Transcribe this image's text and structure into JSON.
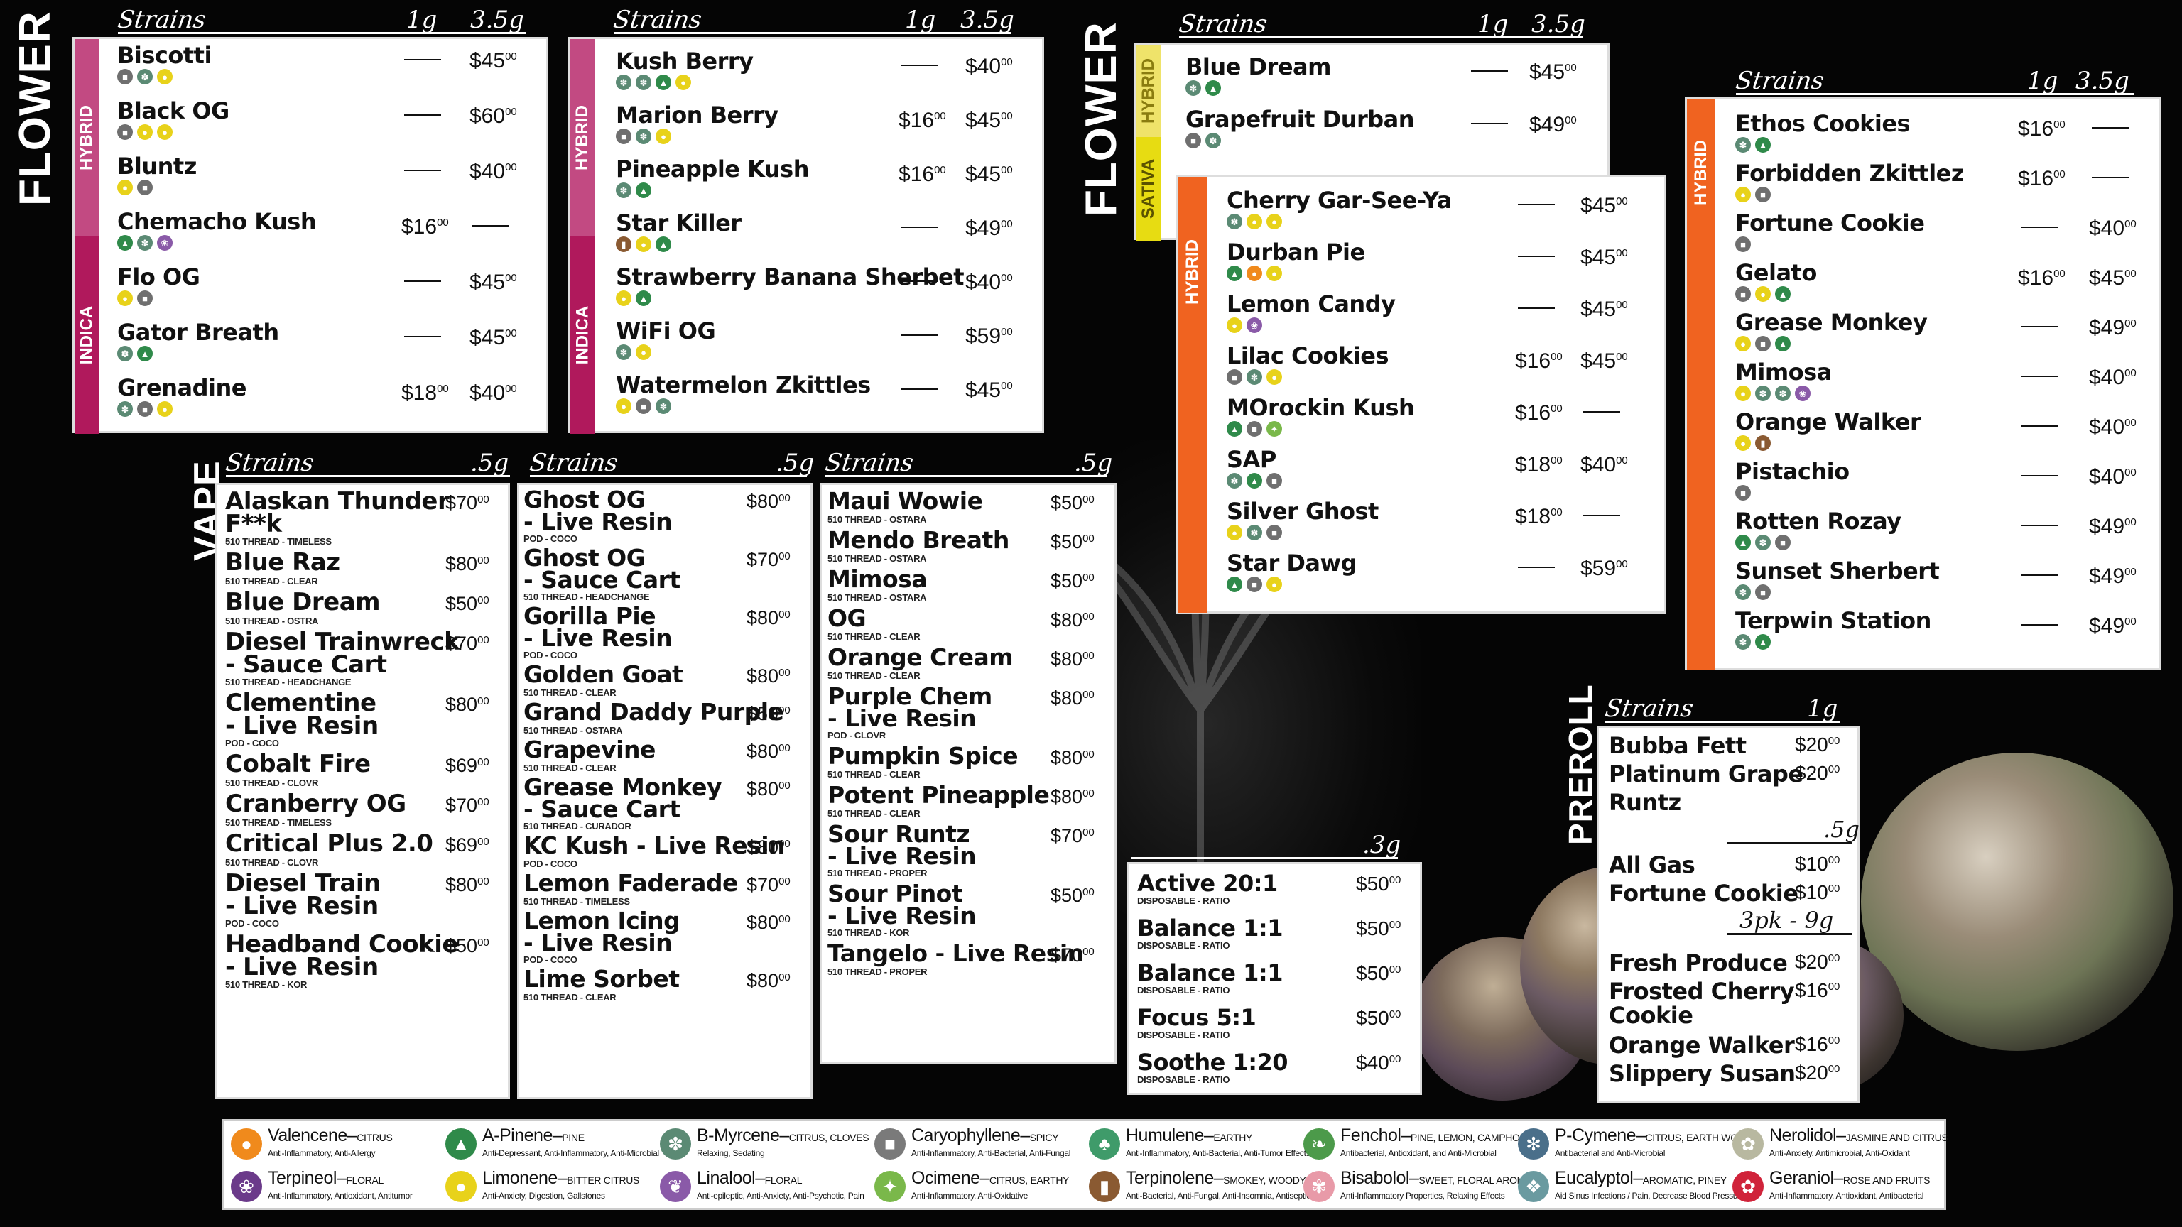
{
  "sections": {
    "flower": "FLOWER",
    "vape": "VAPE",
    "preroll": "PREROLL"
  },
  "headers": {
    "strains": "Strains",
    "g1": "1g",
    "g35": "3.5g",
    "g05": ".5g",
    "g03": ".3g",
    "pk3": "3pk - 9g"
  },
  "tags": {
    "indica_hybrid_a": {
      "indica": "INDICA",
      "hybrid": "HYBRID"
    },
    "indica_hybrid_b": {
      "indica": "INDICA",
      "hybrid": "HYBRID"
    },
    "sativa_hybrid": {
      "sativa": "SATIVA",
      "hybrid": "HYBRID"
    },
    "hybrid_mid": "HYBRID",
    "hybrid_right": "HYBRID"
  },
  "panel1": [
    {
      "name": "Biscotti",
      "p1": "",
      "p2": "$45",
      "icons": [
        "gray",
        "sage",
        "yellow"
      ]
    },
    {
      "name": "Black OG",
      "p1": "",
      "p2": "$60",
      "icons": [
        "gray",
        "yellow",
        "yellow"
      ]
    },
    {
      "name": "Bluntz",
      "p1": "",
      "p2": "$40",
      "icons": [
        "yellow",
        "gray"
      ]
    },
    {
      "name": "Chemacho Kush",
      "p1": "$16",
      "p2": "",
      "icons": [
        "pine",
        "sage",
        "purple"
      ]
    },
    {
      "name": "Flo OG",
      "p1": "",
      "p2": "$45",
      "icons": [
        "yellow",
        "gray"
      ]
    },
    {
      "name": "Gator Breath",
      "p1": "",
      "p2": "$45",
      "icons": [
        "sage",
        "pine"
      ]
    },
    {
      "name": "Grenadine",
      "p1": "$18",
      "p2": "$40",
      "icons": [
        "sage",
        "gray",
        "yellow"
      ]
    }
  ],
  "panel2": [
    {
      "name": "Kush Berry",
      "p1": "",
      "p2": "$40",
      "icons": [
        "sage",
        "sage",
        "pine",
        "yellow"
      ]
    },
    {
      "name": "Marion Berry",
      "p1": "$16",
      "p2": "$45",
      "icons": [
        "gray",
        "sage",
        "yellow"
      ]
    },
    {
      "name": "Pineapple Kush",
      "p1": "$16",
      "p2": "$45",
      "icons": [
        "sage",
        "pine"
      ]
    },
    {
      "name": "Star Killer",
      "p1": "",
      "p2": "$49",
      "icons": [
        "wood",
        "yellow",
        "pine"
      ]
    },
    {
      "name": "Strawberry Banana Sherbet",
      "p1": "",
      "p2": "$40",
      "icons": [
        "yellow",
        "pine"
      ]
    },
    {
      "name": "WiFi OG",
      "p1": "",
      "p2": "$59",
      "icons": [
        "sage",
        "yellow"
      ]
    },
    {
      "name": "Watermelon Zkittles",
      "p1": "",
      "p2": "$45",
      "icons": [
        "yellow",
        "gray",
        "sage"
      ]
    }
  ],
  "panel3": [
    {
      "name": "Blue Dream",
      "p1": "",
      "p2": "$45",
      "icons": [
        "sage",
        "pine"
      ]
    },
    {
      "name": "Grapefruit Durban",
      "p1": "",
      "p2": "$49",
      "icons": [
        "gray",
        "sage"
      ]
    }
  ],
  "panel4": [
    {
      "name": "Cherry Gar-See-Ya",
      "p1": "",
      "p2": "$45",
      "icons": [
        "sage",
        "yellow",
        "yellow"
      ]
    },
    {
      "name": "Durban Pie",
      "p1": "",
      "p2": "$45",
      "icons": [
        "pine",
        "orange",
        "yellow"
      ]
    },
    {
      "name": "Lemon Candy",
      "p1": "",
      "p2": "$45",
      "icons": [
        "yellow",
        "purple"
      ]
    },
    {
      "name": "Lilac Cookies",
      "p1": "$16",
      "p2": "$45",
      "icons": [
        "gray",
        "sage",
        "yellow"
      ]
    },
    {
      "name": "MOrockin Kush",
      "p1": "$16",
      "p2": "",
      "icons": [
        "pine",
        "gray",
        "mint"
      ]
    },
    {
      "name": "SAP",
      "p1": "$18",
      "p2": "$40",
      "icons": [
        "sage",
        "pine",
        "gray"
      ]
    },
    {
      "name": "Silver Ghost",
      "p1": "$18",
      "p2": "",
      "icons": [
        "yellow",
        "sage",
        "gray"
      ]
    },
    {
      "name": "Star Dawg",
      "p1": "",
      "p2": "$59",
      "icons": [
        "pine",
        "gray",
        "yellow"
      ]
    }
  ],
  "panel5": [
    {
      "name": "Ethos Cookies",
      "p1": "$16",
      "p2": "",
      "icons": [
        "sage",
        "pine"
      ]
    },
    {
      "name": "Forbidden Zkittlez",
      "p1": "$16",
      "p2": "",
      "icons": [
        "yellow",
        "gray"
      ]
    },
    {
      "name": "Fortune Cookie",
      "p1": "",
      "p2": "$40",
      "icons": [
        "gray"
      ]
    },
    {
      "name": "Gelato",
      "p1": "$16",
      "p2": "$45",
      "icons": [
        "gray",
        "yellow",
        "pine"
      ]
    },
    {
      "name": "Grease Monkey",
      "p1": "",
      "p2": "$49",
      "icons": [
        "yellow",
        "gray",
        "pine"
      ]
    },
    {
      "name": "Mimosa",
      "p1": "",
      "p2": "$40",
      "icons": [
        "yellow",
        "sage",
        "sage",
        "purple"
      ]
    },
    {
      "name": "Orange Walker",
      "p1": "",
      "p2": "$40",
      "icons": [
        "yellow",
        "wood"
      ]
    },
    {
      "name": "Pistachio",
      "p1": "",
      "p2": "$40",
      "icons": [
        "gray"
      ]
    },
    {
      "name": "Rotten Rozay",
      "p1": "",
      "p2": "$49",
      "icons": [
        "pine",
        "sage",
        "gray"
      ]
    },
    {
      "name": "Sunset Sherbert",
      "p1": "",
      "p2": "$49",
      "icons": [
        "sage",
        "gray"
      ]
    },
    {
      "name": "Terpwin Station",
      "p1": "",
      "p2": "$49",
      "icons": [
        "sage",
        "pine"
      ]
    }
  ],
  "vape1": [
    {
      "name": "Alaskan Thunder",
      "name2": "F**k",
      "sub": "510 THREAD - TIMELESS",
      "price": "$70"
    },
    {
      "name": "Blue Raz",
      "name2": "",
      "sub": "510 THREAD - CLEAR",
      "price": "$80"
    },
    {
      "name": "Blue Dream",
      "name2": "",
      "sub": "510 THREAD - OSTRA",
      "price": "$50"
    },
    {
      "name": "Diesel Trainwreck",
      "name2": "- Sauce Cart",
      "sub": "510 THREAD - HEADCHANGE",
      "price": "$70"
    },
    {
      "name": "Clementine",
      "name2": "- Live Resin",
      "sub": "POD - COCO",
      "price": "$80"
    },
    {
      "name": "Cobalt Fire",
      "name2": "",
      "sub": "510 THREAD - CLOVR",
      "price": "$69"
    },
    {
      "name": "Cranberry OG",
      "name2": "",
      "sub": "510 THREAD - TIMELESS",
      "price": "$70"
    },
    {
      "name": "Critical Plus 2.0",
      "name2": "",
      "sub": "510 THREAD - CLOVR",
      "price": "$69"
    },
    {
      "name": "Diesel Train",
      "name2": "- Live Resin",
      "sub": "POD - COCO",
      "price": "$80"
    },
    {
      "name": "Headband Cookie",
      "name2": "- Live Resin",
      "sub": "510 THREAD - KOR",
      "price": "$50"
    }
  ],
  "vape2": [
    {
      "name": "Ghost OG",
      "name2": "- Live Resin",
      "sub": "POD - COCO",
      "price": "$80"
    },
    {
      "name": "Ghost OG",
      "name2": "- Sauce Cart",
      "sub": "510 THREAD - HEADCHANGE",
      "price": "$70"
    },
    {
      "name": "Gorilla Pie",
      "name2": "- Live Resin",
      "sub": "POD - COCO",
      "price": "$80"
    },
    {
      "name": "Golden Goat",
      "name2": "",
      "sub": "510 THREAD - CLEAR",
      "price": "$80"
    },
    {
      "name": "Grand Daddy Purple",
      "name2": "",
      "sub": "510 THREAD - OSTARA",
      "price": "$50"
    },
    {
      "name": "Grapevine",
      "name2": "",
      "sub": "510 THREAD - CLEAR",
      "price": "$80"
    },
    {
      "name": "Grease Monkey",
      "name2": "- Sauce Cart",
      "sub": "510 THREAD - CURADOR",
      "price": "$80"
    },
    {
      "name": "KC Kush - Live Resin",
      "name2": "",
      "sub": "POD - COCO",
      "price": "$80"
    },
    {
      "name": "Lemon Faderade",
      "name2": "",
      "sub": "510 THREAD - TIMELESS",
      "price": "$70"
    },
    {
      "name": "Lemon Icing",
      "name2": "- Live Resin",
      "sub": "POD - COCO",
      "price": "$80"
    },
    {
      "name": "Lime Sorbet",
      "name2": "",
      "sub": "510 THREAD - CLEAR",
      "price": "$80"
    }
  ],
  "vape3": [
    {
      "name": "Maui Wowie",
      "name2": "",
      "sub": "510 THREAD - OSTARA",
      "price": "$50"
    },
    {
      "name": "Mendo Breath",
      "name2": "",
      "sub": "510 THREAD - OSTARA",
      "price": "$50"
    },
    {
      "name": "Mimosa",
      "name2": "",
      "sub": "510 THREAD - OSTARA",
      "price": "$50"
    },
    {
      "name": "OG",
      "name2": "",
      "sub": "510 THREAD - CLEAR",
      "price": "$80"
    },
    {
      "name": "Orange Cream",
      "name2": "",
      "sub": "510 THREAD - CLEAR",
      "price": "$80"
    },
    {
      "name": "Purple Chem",
      "name2": "- Live Resin",
      "sub": "POD - CLOVR",
      "price": "$80"
    },
    {
      "name": "Pumpkin Spice",
      "name2": "",
      "sub": "510 THREAD - CLEAR",
      "price": "$80"
    },
    {
      "name": "Potent Pineapple",
      "name2": "",
      "sub": "510 THREAD - CLEAR",
      "price": "$80"
    },
    {
      "name": "Sour Runtz",
      "name2": "- Live Resin",
      "sub": "510 THREAD - PROPER",
      "price": "$70"
    },
    {
      "name": "Sour Pinot",
      "name2": "- Live Resin",
      "sub": "510 THREAD - KOR",
      "price": "$50"
    },
    {
      "name": "Tangelo - Live Resin",
      "name2": "",
      "sub": "510 THREAD - PROPER",
      "price": "$70"
    }
  ],
  "disposable": [
    {
      "name": "Active 20:1",
      "sub": "DISPOSABLE - RATIO",
      "price": "$50"
    },
    {
      "name": "Balance 1:1",
      "sub": "DISPOSABLE - RATIO",
      "price": "$50"
    },
    {
      "name": "Balance 1:1",
      "sub": "DISPOSABLE - RATIO",
      "price": "$50"
    },
    {
      "name": "Focus 5:1",
      "sub": "DISPOSABLE - RATIO",
      "price": "$50"
    },
    {
      "name": "Soothe 1:20",
      "sub": "DISPOSABLE - RATIO",
      "price": "$40"
    }
  ],
  "preroll": {
    "g1": [
      {
        "name": "Bubba Fett",
        "price": "$20"
      },
      {
        "name": "Platinum Grape",
        "price": "$20"
      },
      {
        "name": "Runtz",
        "price": ""
      }
    ],
    "g05": [
      {
        "name": "All Gas",
        "price": "$10"
      },
      {
        "name": "Fortune Cookie",
        "price": "$10"
      }
    ],
    "pk": [
      {
        "name": "Fresh Produce",
        "price": "$20"
      },
      {
        "name": "Frosted Cherry",
        "name2": "Cookie",
        "price": "$16"
      },
      {
        "name": "Orange Walker",
        "price": "$16"
      },
      {
        "name": "Slippery Susan",
        "price": "$20"
      }
    ]
  },
  "cents": "00",
  "legend": [
    {
      "name": "Valencene",
      "tag": "CITRUS",
      "desc": "Anti-Inflammatory, Anti-Allergy",
      "icon": "orange-icon",
      "color": "#f08a1c",
      "glyph": "●"
    },
    {
      "name": "A-Pinene",
      "tag": "PINE",
      "desc": "Anti-Depressant, Anti-Inflammatory, Anti-Microbial",
      "icon": "pine-icon",
      "color": "#2f8a4a",
      "glyph": "▲"
    },
    {
      "name": "B-Myrcene",
      "tag": "CITRUS, CLOVES",
      "desc": "Relaxing, Sedating",
      "icon": "hops-icon",
      "color": "#5b8a74",
      "glyph": "✽"
    },
    {
      "name": "Caryophyllene",
      "tag": "SPICY",
      "desc": "Anti-Inflammatory, Anti-Bacterial, Anti-Fungal",
      "icon": "pepper-grinder-icon",
      "color": "#7a7a7a",
      "glyph": "■"
    },
    {
      "name": "Humulene",
      "tag": "EARTHY",
      "desc": "Anti-Inflammatory, Anti-Bacterial, Anti-Tumor Effects",
      "icon": "leaf-icon",
      "color": "#3f9b6a",
      "glyph": "♣"
    },
    {
      "name": "Fenchol",
      "tag": "PINE, LEMON, CAMPHOR",
      "desc": "Antibacterial, Antioxidant, and Anti-Microbial",
      "icon": "basil-icon",
      "color": "#4c9a4a",
      "glyph": "❧"
    },
    {
      "name": "P-Cymene",
      "tag": "CITRUS, EARTH WOOD",
      "desc": "Antibacterial and Anti-Microbial",
      "icon": "spice-icon",
      "color": "#4a6f8a",
      "glyph": "✻"
    },
    {
      "name": "Nerolidol",
      "tag": "JASMINE AND CITRUS",
      "desc": "Anti-Anxiety, Antimicrobial, Anti-Oxidant",
      "icon": "jasmine-icon",
      "color": "#b8b8a0",
      "glyph": "✿"
    },
    {
      "name": "Terpineol",
      "tag": "FLORAL",
      "desc": "Anti-Inflammatory, Antioxidant, Antitumor",
      "icon": "lilac-icon",
      "color": "#6b3a8a",
      "glyph": "❀"
    },
    {
      "name": "Limonene",
      "tag": "BITTER CITRUS",
      "desc": "Anti-Anxiety, Digestion, Gallstones",
      "icon": "lemon-icon",
      "color": "#e8d21a",
      "glyph": "●"
    },
    {
      "name": "Linalool",
      "tag": "FLORAL",
      "desc": "Anti-epileptic, Anti-Anxiety, Anti-Psychotic, Pain",
      "icon": "lavender-icon",
      "color": "#8a5aa8",
      "glyph": "❦"
    },
    {
      "name": "Ocimene",
      "tag": "CITRUS, EARTHY",
      "desc": "Anti-Inflammatory, Anti-Oxidative",
      "icon": "mint-icon",
      "color": "#7ab84a",
      "glyph": "✦"
    },
    {
      "name": "Terpinolene",
      "tag": "SMOKEY, WOODY",
      "desc": "Anti-Bacterial, Anti-Fungal, Anti-Insomnia, Antiseptic",
      "icon": "wood-icon",
      "color": "#8a5a32",
      "glyph": "▮"
    },
    {
      "name": "Bisabolol",
      "tag": "SWEET, FLORAL AROMA",
      "desc": "Anti-Inflammatory Properties, Relaxing Effects",
      "icon": "chamomile-icon",
      "color": "#e89aa8",
      "glyph": "✾"
    },
    {
      "name": "Eucalyptol",
      "tag": "AROMATIC, PINEY",
      "desc": "Aid Sinus Infections / Pain, Decrease Blood Pressure",
      "icon": "eucalyptus-icon",
      "color": "#6a9aa0",
      "glyph": "❖"
    },
    {
      "name": "Geraniol",
      "tag": "ROSE AND FRUITS",
      "desc": "Anti-Inflammatory, Antioxidant, Antibacterial",
      "icon": "rose-icon",
      "color": "#d0233a",
      "glyph": "✿"
    }
  ],
  "icon_colors": {
    "gray": "#6f6f6f",
    "sage": "#5b8a74",
    "yellow": "#e8d21a",
    "pine": "#2f8a4a",
    "purple": "#8a5aa8",
    "orange": "#f08a1c",
    "wood": "#8a5a32",
    "mint": "#7ab84a"
  },
  "colors": {
    "indica": "#b0195c",
    "hybrid_pink": "#c24a82",
    "sativa": "#e7dc12",
    "hybrid_yellow": "#efe36a",
    "hybrid_orange": "#f06320"
  }
}
